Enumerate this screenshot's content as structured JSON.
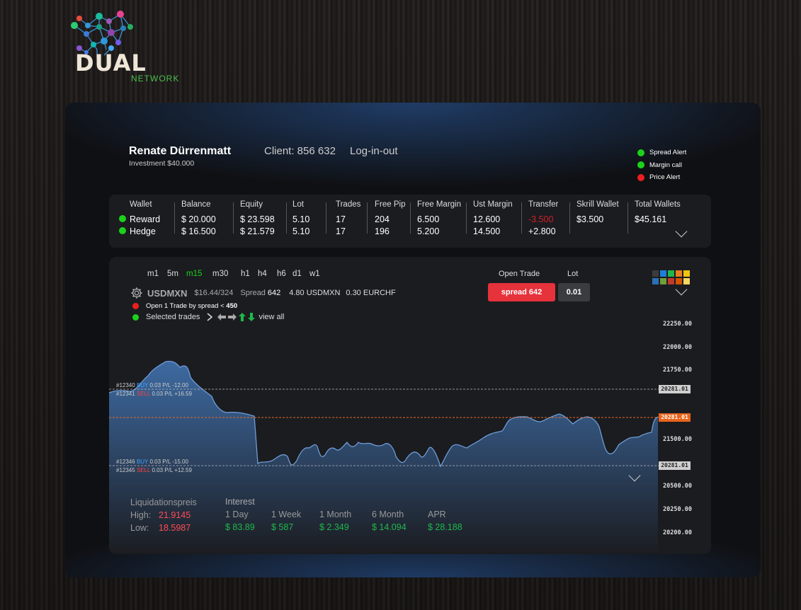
{
  "brand": {
    "word": "DUAL",
    "sub": "NETWORK"
  },
  "user": {
    "name": "Renate Dürrenmatt",
    "investment": "Investment $40.000",
    "client": "Client: 856 632",
    "login": "Log-in-out"
  },
  "alerts": [
    {
      "label": "Spread Alert",
      "color": "#1bd21b"
    },
    {
      "label": "Margin call",
      "color": "#1bd21b"
    },
    {
      "label": "Price Alert",
      "color": "#ec1f1f"
    }
  ],
  "wallet": {
    "headers": [
      "Wallet",
      "Balance",
      "Equity",
      "Lot",
      "Trades",
      "Free Pip",
      "Free Margin",
      "Ust Margin",
      "Transfer",
      "Skrill Wallet",
      "Total Wallets"
    ],
    "rows": [
      {
        "wallet": "Reward",
        "balance": "$ 20.000",
        "equity": "$ 23.598",
        "lot": "5.10",
        "trades": "17",
        "free_pip": "204",
        "free_margin": "6.500",
        "ust_margin": "12.600",
        "transfer": "-3.500",
        "skrill": "$3.500",
        "total": "$45.161"
      },
      {
        "wallet": "Hedge",
        "balance": "$ 16.500",
        "equity": "$ 21.579",
        "lot": "5.10",
        "trades": "17",
        "free_pip": "196",
        "free_margin": "5.200",
        "ust_margin": "14.500",
        "transfer": "+2.800"
      }
    ]
  },
  "timeframes": [
    "m1",
    "5m",
    "m15",
    "m30",
    "h1",
    "h4",
    "h6",
    "d1",
    "w1"
  ],
  "active_timeframe": "m15",
  "symbol": {
    "name": "USDMXN",
    "price": "$16.44/324",
    "spread_label": "Spread",
    "spread_value": "642",
    "usd": "4.80 USDMXN",
    "eur": "0.30 EURCHF"
  },
  "trade_info": {
    "open_trade_text": "Open 1 Trade by spread <",
    "open_trade_value": "450",
    "selected": "Selected trades",
    "view_all": "view all"
  },
  "open_trade": {
    "label": "Open Trade",
    "button": "spread 642",
    "lot_label": "Lot",
    "lot_value": "0.01"
  },
  "palette": [
    "#3c3c3c",
    "#1f7fd8",
    "#1fb84a",
    "#e67e22",
    "#f1c40f",
    "#2b6fb5",
    "#6f9f3a",
    "#c0392b",
    "#d35400",
    "#f6d860"
  ],
  "chart_data": {
    "type": "area",
    "y_ticks": [
      "22250.00",
      "22000.00",
      "21750.00",
      "21500.00",
      "20500.00",
      "20250.00",
      "20200.00"
    ],
    "trades": [
      {
        "id": "#12340",
        "side": "BUY",
        "lot": "0.03",
        "pl": "P/L -12.00"
      },
      {
        "id": "#12341",
        "side": "SELL",
        "lot": "0.03",
        "pl": "P/L +16.59"
      },
      {
        "id": "#12346",
        "side": "BUY",
        "lot": "0.03",
        "pl": "P/L -15.00"
      },
      {
        "id": "#12345",
        "side": "SELL",
        "lot": "0.03",
        "pl": "P/L +12.59"
      }
    ],
    "price_tags": [
      "20281.01",
      "20281.01",
      "20281.01"
    ]
  },
  "liquidation": {
    "title": "Liquidationspreis",
    "high_label": "High:",
    "high": "21.9145",
    "low_label": "Low:",
    "low": "18.5987"
  },
  "interest": {
    "title": "Interest",
    "cols": [
      {
        "label": "1 Day",
        "value": "$ 83.89"
      },
      {
        "label": "1 Week",
        "value": "$ 587"
      },
      {
        "label": "1 Month",
        "value": "$ 2.349"
      },
      {
        "label": "6 Month",
        "value": "$ 14.094"
      },
      {
        "label": "APR",
        "value": "$ 28.188"
      }
    ]
  }
}
